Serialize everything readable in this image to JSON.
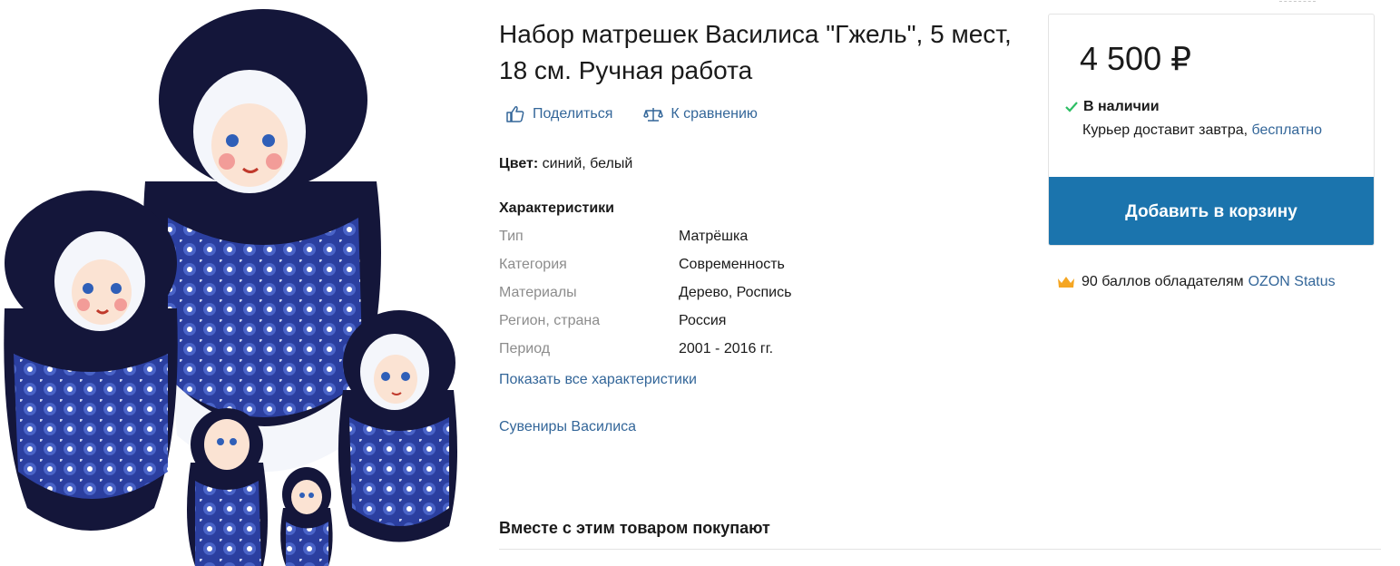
{
  "product": {
    "title": "Набор матрешек Василиса \"Гжель\", 5 мест, 18 см. Ручная работа",
    "image_icon": "matryoshka-set-image"
  },
  "actions": {
    "share_label": "Поделиться",
    "compare_label": "К сравнению"
  },
  "color": {
    "label": "Цвет:",
    "value": "синий, белый"
  },
  "specs": {
    "title": "Характеристики",
    "rows": [
      {
        "key": "Тип",
        "value": "Матрёшка"
      },
      {
        "key": "Категория",
        "value": "Современность"
      },
      {
        "key": "Материалы",
        "value": "Дерево, Роспись"
      },
      {
        "key": "Регион, страна",
        "value": "Россия"
      },
      {
        "key": "Период",
        "value": "2001 - 2016 гг."
      }
    ],
    "show_all_label": "Показать все характеристики"
  },
  "brand_link": "Сувениры Василиса",
  "together_title": "Вместе с этим товаром покупают",
  "buy_box": {
    "price": "4 500 ₽",
    "stock": "В наличии",
    "delivery_text": "Курьер доставит завтра,",
    "delivery_free": "бесплатно",
    "cart_button": "Добавить в корзину"
  },
  "points": {
    "text": "90 баллов обладателям",
    "status_link": "OZON Status"
  },
  "colors": {
    "link": "#336699",
    "cart_button_bg": "#1b74ad",
    "stock_check": "#2dbe64",
    "crown": "#f5a623",
    "doll_blue": "#1c2d7a",
    "doll_dark": "#14163a"
  }
}
